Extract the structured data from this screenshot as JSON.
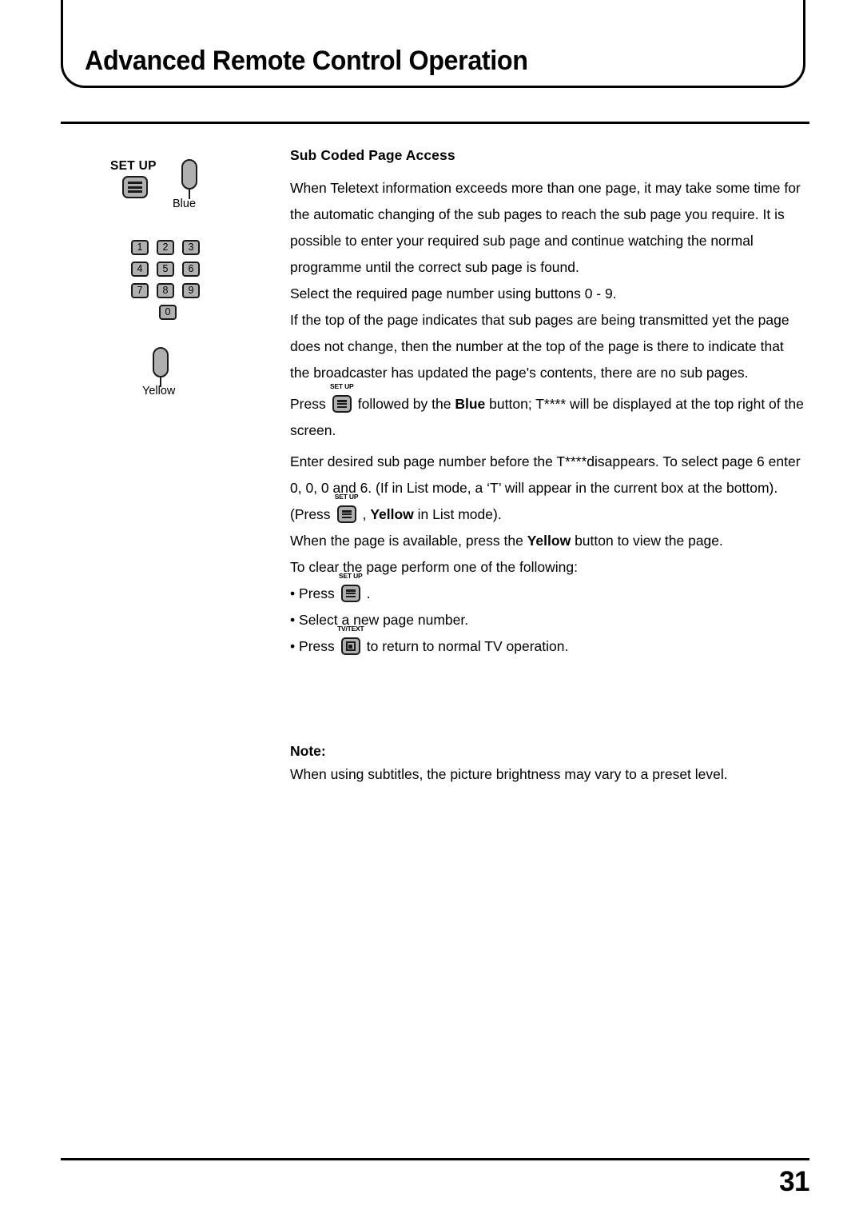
{
  "header": {
    "title": "Advanced Remote Control Operation"
  },
  "sidebar": {
    "setup_label": "SET UP",
    "setup_icon": "setup-list-icon",
    "blue_button": {
      "caption": "Blue",
      "icon": "blue-color-button"
    },
    "yellow_button": {
      "caption": "Yellow",
      "icon": "yellow-color-button"
    },
    "keypad": {
      "rows": [
        [
          "1",
          "2",
          "3"
        ],
        [
          "4",
          "5",
          "6"
        ],
        [
          "7",
          "8",
          "9"
        ]
      ],
      "zero": "0"
    }
  },
  "content": {
    "section_heading": "Sub Coded Page Access",
    "paragraph_1": "When Teletext information exceeds more than one page, it may take some time for the automatic changing of the sub pages to reach the sub page you require. It is possible to enter your required sub page and continue watching the normal programme until the correct sub page is found.",
    "paragraph_2": "Select the required page number using buttons 0 - 9.",
    "paragraph_3": "If the top of the page indicates that sub pages are being transmitted yet the page does not change, then the number at the top of the page is there to indicate that the broadcaster has updated the page's contents, there are no sub pages.",
    "press_line": {
      "prefix": "Press",
      "icon_caption": "SET UP",
      "icon_name": "setup-inline-icon",
      "mid_1": "followed by the",
      "bold_1": "Blue",
      "suffix": "button; T**** will be displayed at the top right of the screen."
    },
    "paragraph_4": "Enter desired sub page number before the T****disappears. To select page 6 enter 0, 0, 0 and 6. (If in List mode, a ‘T’ will appear in the current box at the bottom).",
    "list_mode_line": {
      "prefix": "(Press",
      "icon_caption": "SET UP",
      "icon_name": "setup-inline-icon",
      "comma": ",",
      "bold": "Yellow",
      "suffix": "in List mode)."
    },
    "paragraph_5_pre": "When the page is available, press the",
    "paragraph_5_bold": "Yellow",
    "paragraph_5_post": "button to view the page.",
    "paragraph_6": "To clear the page perform one of the following:",
    "bullets": {
      "bullet_1": {
        "marker": "•",
        "prefix": "Press",
        "icon_caption": "SET UP",
        "icon_name": "setup-inline-icon",
        "suffix": "."
      },
      "bullet_2": {
        "marker": "•",
        "text": "Select a new page number."
      },
      "bullet_3": {
        "marker": "•",
        "prefix": "Press",
        "icon_caption": "TV/TEXT",
        "icon_name": "tvtext-inline-icon",
        "suffix": "to return to normal TV operation."
      }
    },
    "note_heading": "Note:",
    "note_text": "When using subtitles, the picture brightness may vary to a preset level."
  },
  "footer": {
    "page_number": "31"
  },
  "colors": {
    "key_face": "#b0b0b0",
    "key_border": "#1a1a1a",
    "text": "#000000",
    "background": "#ffffff"
  }
}
